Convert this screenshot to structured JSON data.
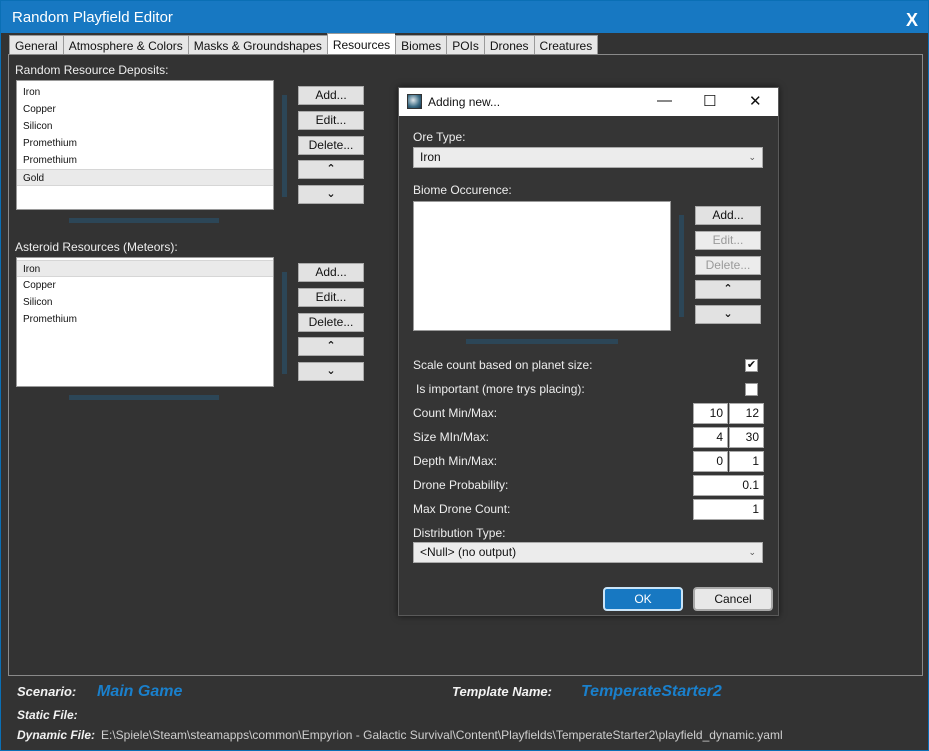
{
  "window": {
    "title": "Random Playfield Editor",
    "close_label": "X"
  },
  "tabs": [
    {
      "label": "General"
    },
    {
      "label": "Atmosphere & Colors"
    },
    {
      "label": "Masks & Groundshapes"
    },
    {
      "label": "Resources"
    },
    {
      "label": "Biomes"
    },
    {
      "label": "POIs"
    },
    {
      "label": "Drones"
    },
    {
      "label": "Creatures"
    }
  ],
  "deposits": {
    "label": "Random Resource Deposits:",
    "items": [
      "Iron",
      "Copper",
      "Silicon",
      "Promethium",
      "Promethium",
      "Gold"
    ],
    "add_label": "Add...",
    "edit_label": "Edit...",
    "delete_label": "Delete...",
    "up_label": "⌃",
    "down_label": "⌄"
  },
  "asteroids": {
    "label": "Asteroid Resources (Meteors):",
    "items": [
      "Iron",
      "Copper",
      "Silicon",
      "Promethium"
    ],
    "add_label": "Add...",
    "edit_label": "Edit...",
    "delete_label": "Delete...",
    "up_label": "⌃",
    "down_label": "⌄"
  },
  "footer": {
    "scenario_label": "Scenario:",
    "scenario_value": "Main Game",
    "template_label": "Template Name:",
    "template_value": "TemperateStarter2",
    "static_label": "Static File:",
    "static_value": "",
    "dynamic_label": "Dynamic File:",
    "dynamic_value": "E:\\Spiele\\Steam\\steamapps\\common\\Empyrion - Galactic Survival\\Content\\Playfields\\TemperateStarter2\\playfield_dynamic.yaml"
  },
  "dialog": {
    "title": "Adding new...",
    "minimize": "—",
    "maximize": "☐",
    "close": "✕",
    "ore_type_label": "Ore Type:",
    "ore_type_value": "Iron",
    "biome_label": "Biome Occurence:",
    "biome_add": "Add...",
    "biome_edit": "Edit...",
    "biome_delete": "Delete...",
    "biome_up": "⌃",
    "biome_down": "⌄",
    "scale_label": "Scale count based on planet size:",
    "scale_checked": "✔",
    "important_label": "Is important (more trys placing):",
    "important_checked": "",
    "count_label": "Count Min/Max:",
    "count_min": "10",
    "count_max": "12",
    "size_label": "Size MIn/Max:",
    "size_min": "4",
    "size_max": "30",
    "depth_label": "Depth Min/Max:",
    "depth_min": "0",
    "depth_max": "1",
    "drone_prob_label": "Drone Probability:",
    "drone_prob_value": "0.1",
    "max_drone_label": "Max Drone Count:",
    "max_drone_value": "1",
    "distribution_label": "Distribution Type:",
    "distribution_value": "<Null> (no output)",
    "ok_label": "OK",
    "cancel_label": "Cancel"
  }
}
